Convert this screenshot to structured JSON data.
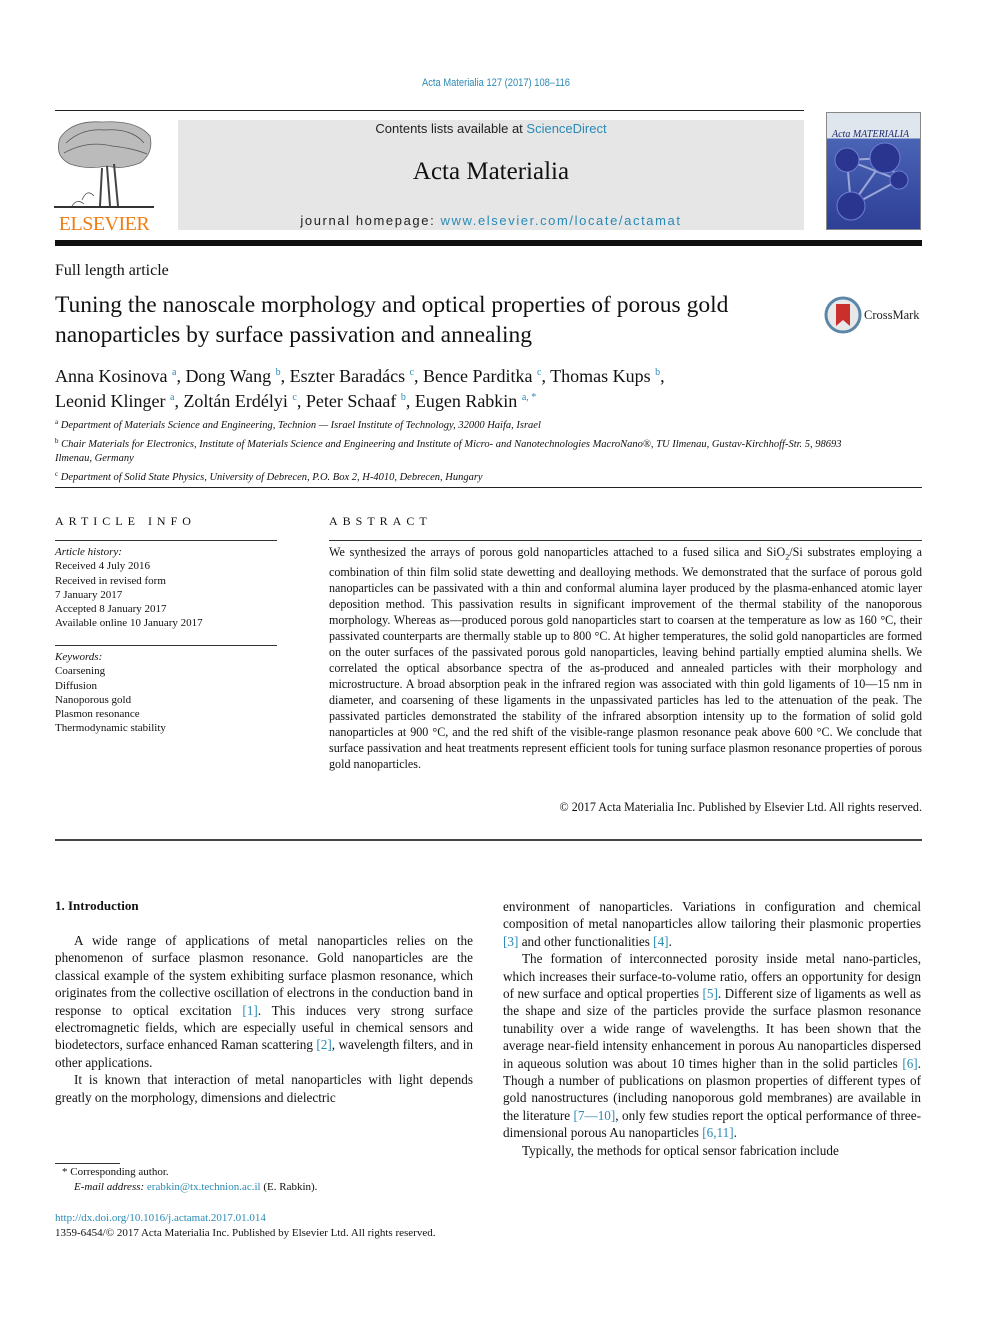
{
  "journal_ref": "Acta Materialia 127 (2017) 108–116",
  "header": {
    "contents_prefix": "Contents lists available at ",
    "contents_link": "ScienceDirect",
    "journal_name": "Acta Materialia",
    "homepage_prefix": "journal homepage: ",
    "homepage_link": "www.elsevier.com/locate/actamat",
    "publisher_logo_text": "ELSEVIER",
    "cover_title": "Acta MATERIALIA"
  },
  "article": {
    "type": "Full length article",
    "title": "Tuning the nanoscale morphology and optical properties of porous gold nanoparticles by surface passivation and annealing",
    "crossmark_label": "CrossMark",
    "authors": [
      {
        "name": "Anna Kosinova",
        "aff": "a",
        "sep": ", "
      },
      {
        "name": "Dong Wang",
        "aff": "b",
        "sep": ", "
      },
      {
        "name": "Eszter Baradács",
        "aff": "c",
        "sep": ", "
      },
      {
        "name": "Bence Parditka",
        "aff": "c",
        "sep": ", "
      },
      {
        "name": "Thomas Kups",
        "aff": "b",
        "sep": ","
      },
      {
        "name": "Leonid Klinger",
        "aff": "a",
        "sep": ", "
      },
      {
        "name": "Zoltán Erdélyi",
        "aff": "c",
        "sep": ", "
      },
      {
        "name": "Peter Schaaf",
        "aff": "b",
        "sep": ", "
      },
      {
        "name": "Eugen Rabkin",
        "aff": "a, *",
        "sep": ""
      }
    ],
    "affiliations": [
      {
        "key": "a",
        "text": "Department of Materials Science and Engineering, Technion — Israel Institute of Technology, 32000 Haifa, Israel"
      },
      {
        "key": "b",
        "text": "Chair Materials for Electronics, Institute of Materials Science and Engineering and Institute of Micro- and Nanotechnologies MacroNano®, TU Ilmenau, Gustav-Kirchhoff-Str. 5, 98693 Ilmenau, Germany"
      },
      {
        "key": "c",
        "text": "Department of Solid State Physics, University of Debrecen, P.O. Box 2, H-4010, Debrecen, Hungary"
      }
    ]
  },
  "article_info": {
    "heading": "ARTICLE INFO",
    "history_label": "Article history:",
    "history": [
      "Received 4 July 2016",
      "Received in revised form",
      "7 January 2017",
      "Accepted 8 January 2017",
      "Available online 10 January 2017"
    ],
    "keywords_label": "Keywords:",
    "keywords": [
      "Coarsening",
      "Diffusion",
      "Nanoporous gold",
      "Plasmon resonance",
      "Thermodynamic stability"
    ]
  },
  "abstract": {
    "heading": "ABSTRACT",
    "text_before_sub": "We synthesized the arrays of porous gold nanoparticles attached to a fused silica and SiO",
    "sub": "2",
    "text_after_sub": "/Si substrates employing a combination of thin film solid state dewetting and dealloying methods. We demonstrated that the surface of porous gold nanoparticles can be passivated with a thin and conformal alumina layer produced by the plasma-enhanced atomic layer deposition method. This passivation results in significant improvement of the thermal stability of the nanoporous morphology. Whereas as—produced porous gold nanoparticles start to coarsen at the temperature as low as 160 °C, their passivated counterparts are thermally stable up to 800 °C. At higher temperatures, the solid gold nanoparticles are formed on the outer surfaces of the passivated porous gold nanoparticles, leaving behind partially emptied alumina shells. We correlated the optical absorbance spectra of the as-produced and annealed particles with their morphology and microstructure. A broad absorption peak in the infrared region was associated with thin gold ligaments of 10—15 nm in diameter, and coarsening of these ligaments in the unpassivated particles has led to the attenuation of the peak. The passivated particles demonstrated the stability of the infrared absorption intensity up to the formation of solid gold nanoparticles at 900 °C, and the red shift of the visible-range plasmon resonance peak above 600 °C. We conclude that surface passivation and heat treatments represent efficient tools for tuning surface plasmon resonance properties of porous gold nanoparticles.",
    "copyright": "© 2017 Acta Materialia Inc. Published by Elsevier Ltd. All rights reserved."
  },
  "introduction": {
    "heading": "1.  Introduction",
    "left": [
      {
        "segments": [
          {
            "t": "A wide range of applications of metal nanoparticles relies on the phenomenon of surface plasmon resonance. Gold nanoparticles are the classical example of the system exhibiting surface plasmon resonance, which originates from the collective oscillation of electrons in the conduction band in response to optical excitation "
          },
          {
            "ref": "[1]"
          },
          {
            "t": ". This induces very strong surface electromagnetic fields, which are especially useful in chemical sensors and biodetectors, surface enhanced Raman scattering "
          },
          {
            "ref": "[2]"
          },
          {
            "t": ", wavelength filters, and in other applications."
          }
        ]
      },
      {
        "segments": [
          {
            "t": "It is known that interaction of metal nanoparticles with light depends greatly on the morphology, dimensions and dielectric"
          }
        ]
      }
    ],
    "right": [
      {
        "noindent": true,
        "segments": [
          {
            "t": "environment of nanoparticles. Variations in configuration and chemical composition of metal nanoparticles allow tailoring their plasmonic properties "
          },
          {
            "ref": "[3]"
          },
          {
            "t": " and other functionalities "
          },
          {
            "ref": "[4]"
          },
          {
            "t": "."
          }
        ]
      },
      {
        "segments": [
          {
            "t": "The formation of interconnected porosity inside metal nano-particles, which increases their surface-to-volume ratio, offers an opportunity for design of new surface and optical properties "
          },
          {
            "ref": "[5]"
          },
          {
            "t": ". Different size of ligaments as well as the shape and size of the particles provide the surface plasmon resonance tunability over a wide range of wavelengths. It has been shown that the average near-field intensity enhancement in porous Au nanoparticles dispersed in aqueous solution was about 10 times higher than in the solid particles "
          },
          {
            "ref": "[6]"
          },
          {
            "t": ". Though a number of publications on plasmon properties of different types of gold nanostructures (including nanoporous gold membranes) are available in the literature "
          },
          {
            "ref": "[7—10]"
          },
          {
            "t": ", only few studies report the optical performance of three-dimensional porous Au nanoparticles "
          },
          {
            "ref": "[6,11]"
          },
          {
            "t": "."
          }
        ]
      },
      {
        "segments": [
          {
            "t": "Typically, the methods for optical sensor fabrication include"
          }
        ]
      }
    ]
  },
  "footnote": {
    "corresponding": "* Corresponding author.",
    "email_label": "E-mail address: ",
    "email": "erabkin@tx.technion.ac.il",
    "email_suffix": " (E. Rabkin).",
    "doi": "http://dx.doi.org/10.1016/j.actamat.2017.01.014",
    "issn_line": "1359-6454/© 2017 Acta Materialia Inc. Published by Elsevier Ltd. All rights reserved."
  },
  "colors": {
    "link": "#2a8ab5",
    "elsevier_orange": "#f07d14",
    "banner_bg": "#e6e6e6"
  }
}
